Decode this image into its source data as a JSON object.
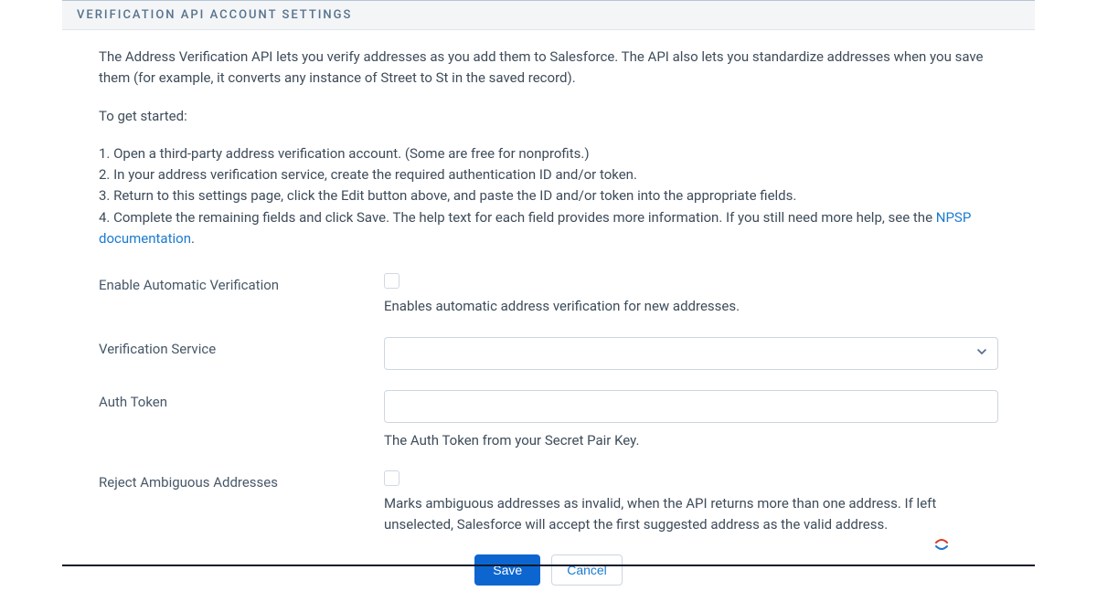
{
  "section_header": "VERIFICATION API ACCOUNT SETTINGS",
  "intro": {
    "p1": "The Address Verification API lets you verify addresses as you add them to Salesforce. The API also lets you standardize addresses when you save them (for example, it converts any instance of Street to St in the saved record).",
    "p2": "To get started:"
  },
  "steps": {
    "s1": "1. Open a third-party address verification account. (Some are free for nonprofits.)",
    "s2": "2. In your address verification service, create the required authentication ID and/or token.",
    "s3": "3. Return to this settings page, click the Edit button above, and paste the ID and/or token into the appropriate fields.",
    "s4_pre": "4. Complete the remaining fields and click Save. The help text for each field provides more information. If you still need more help, see the ",
    "s4_link": "NPSP documentation",
    "s4_post": "."
  },
  "fields": {
    "enable_auto": {
      "label": "Enable Automatic Verification",
      "help": "Enables automatic address verification for new addresses.",
      "checked": false
    },
    "verification_service": {
      "label": "Verification Service",
      "value": ""
    },
    "auth_token": {
      "label": "Auth Token",
      "value": "",
      "help": "The Auth Token from your Secret Pair Key."
    },
    "reject_ambiguous": {
      "label": "Reject Ambiguous Addresses",
      "help": "Marks ambiguous addresses as invalid, when the API returns more than one address. If left unselected, Salesforce will accept the first suggested address as the valid address.",
      "checked": false
    }
  },
  "buttons": {
    "save": "Save",
    "cancel": "Cancel"
  }
}
